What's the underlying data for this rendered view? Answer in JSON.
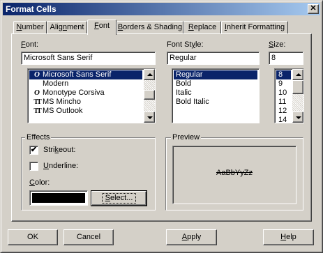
{
  "window": {
    "title": "Format Cells",
    "close_glyph": "✕"
  },
  "tabs": [
    {
      "label_u": "N",
      "label_rest": "umber"
    },
    {
      "label_pre": "Alig",
      "label_u": "n",
      "label_rest": "ment"
    },
    {
      "label_u": "F",
      "label_rest": "ont"
    },
    {
      "label_u": "B",
      "label_rest": "orders & Shading"
    },
    {
      "label_u": "R",
      "label_rest": "eplace"
    },
    {
      "label_u": "I",
      "label_rest": "nherit Formatting"
    }
  ],
  "active_tab": "Font",
  "font": {
    "label_u": "F",
    "label_rest": "ont:",
    "value": "Microsoft Sans Serif",
    "items": [
      {
        "icon": "O",
        "name": "Microsoft Sans Serif",
        "selected": true
      },
      {
        "icon": "",
        "name": "Modern"
      },
      {
        "icon": "O",
        "name": "Monotype Corsiva"
      },
      {
        "icon": "TT",
        "name": "MS Mincho"
      },
      {
        "icon": "TT",
        "name": "MS Outlook"
      }
    ]
  },
  "font_style": {
    "label_pre": "Font St",
    "label_u": "y",
    "label_rest": "le:",
    "value": "Regular",
    "items": [
      "Regular",
      "Bold",
      "Italic",
      "Bold Italic"
    ],
    "selected": "Regular"
  },
  "size": {
    "label_u": "S",
    "label_rest": "ize:",
    "value": "8",
    "items": [
      "8",
      "9",
      "10",
      "11",
      "12",
      "14"
    ],
    "selected": "8"
  },
  "effects": {
    "title": "Effects",
    "strikeout": {
      "label_pre": "Stri",
      "label_u": "k",
      "label_rest": "eout:",
      "checked": true
    },
    "underline": {
      "label_u": "U",
      "label_rest": "nderline:",
      "checked": false
    },
    "color": {
      "label_u": "C",
      "label_rest": "olor:",
      "value": "#000000",
      "select_label_u": "S",
      "select_label_rest": "elect..."
    }
  },
  "preview": {
    "title": "Preview",
    "sample": "AaBbYyZz"
  },
  "buttons": {
    "ok": "OK",
    "cancel": "Cancel",
    "apply_u": "A",
    "apply_rest": "pply",
    "help_u": "H",
    "help_rest": "elp"
  },
  "check_glyph": "✔"
}
